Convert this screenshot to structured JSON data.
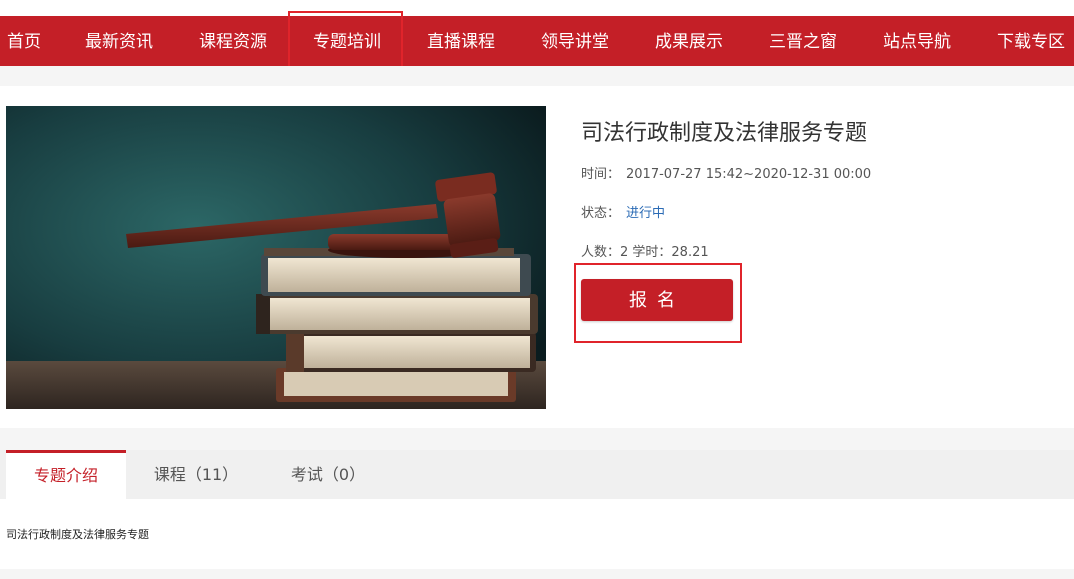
{
  "nav": {
    "items": [
      {
        "label": "首页"
      },
      {
        "label": "最新资讯"
      },
      {
        "label": "课程资源"
      },
      {
        "label": "专题培训"
      },
      {
        "label": "直播课程"
      },
      {
        "label": "领导讲堂"
      },
      {
        "label": "成果展示"
      },
      {
        "label": "三晋之窗"
      },
      {
        "label": "站点导航"
      },
      {
        "label": "下载专区"
      }
    ],
    "active_label": "专题培训"
  },
  "topic": {
    "title": "司法行政制度及法律服务专题",
    "time_label": "时间：",
    "time_value": "2017-07-27 15:42~2020-12-31 00:00",
    "status_label": "状态：",
    "status_value": "进行中",
    "stats_text": "人数：2 学时：28.21",
    "enroll_label": "报名",
    "image_icon": "gavel-on-books-image"
  },
  "tabs": [
    {
      "label": "专题介绍",
      "active": true
    },
    {
      "label": "课程（11）",
      "active": false
    },
    {
      "label": "考试（0）",
      "active": false
    }
  ],
  "intro_text": "司法行政制度及法律服务专题",
  "colors": {
    "brand_red": "#c41f27",
    "highlight_red": "#e0242b",
    "status_blue": "#2b6bb5",
    "page_bg": "#f5f5f5"
  }
}
